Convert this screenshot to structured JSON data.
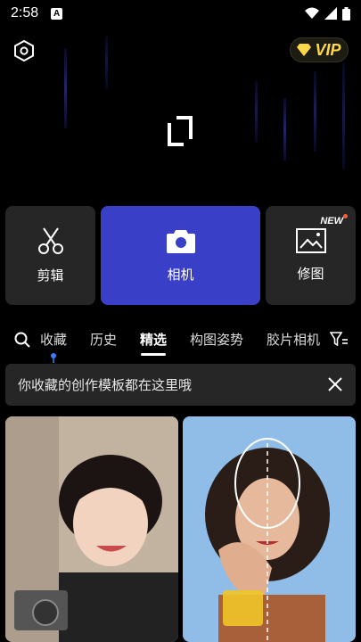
{
  "status": {
    "time": "2:58",
    "badge": "A"
  },
  "hero": {
    "vip_label": "VIP"
  },
  "actions": [
    {
      "label": "剪辑",
      "icon": "scissors-icon"
    },
    {
      "label": "相机",
      "icon": "camera-icon"
    },
    {
      "label": "修图",
      "icon": "image-edit-icon",
      "badge": "NEW"
    }
  ],
  "tabs": [
    "收藏",
    "历史",
    "精选",
    "构图姿势",
    "胶片相机"
  ],
  "active_tab": "精选",
  "banner": {
    "text": "你收藏的创作模板都在这里哦"
  },
  "colors": {
    "accent": "#3a3fc8",
    "vip": "#ffd84a",
    "card": "#262626"
  }
}
